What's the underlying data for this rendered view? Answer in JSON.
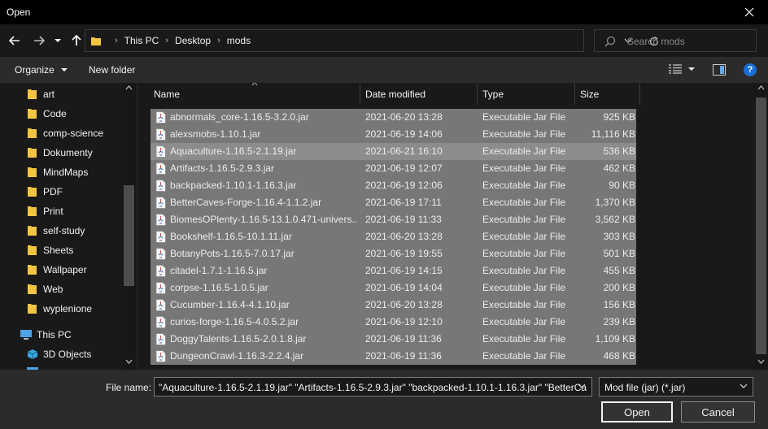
{
  "window": {
    "title": "Open"
  },
  "breadcrumbs": [
    "This PC",
    "Desktop",
    "mods"
  ],
  "search": {
    "placeholder": "Search mods"
  },
  "toolbar": {
    "organize_label": "Organize",
    "new_folder_label": "New folder",
    "help_label": "?"
  },
  "nav": {
    "folders": [
      "art",
      "Code",
      "comp-science",
      "Dokumenty",
      "MindMaps",
      "PDF",
      "Print",
      "self-study",
      "Sheets",
      "Wallpaper",
      "Web",
      "wyplenione"
    ],
    "this_pc": "This PC",
    "objects_3d": "3D Objects"
  },
  "columns": {
    "name": "Name",
    "date": "Date modified",
    "type": "Type",
    "size": "Size"
  },
  "files": [
    {
      "name": "abnormals_core-1.16.5-3.2.0.jar",
      "date": "2021-06-20 13:28",
      "type": "Executable Jar File",
      "size": "925 KB"
    },
    {
      "name": "alexsmobs-1.10.1.jar",
      "date": "2021-06-19 14:06",
      "type": "Executable Jar File",
      "size": "11,116 KB"
    },
    {
      "name": "Aquaculture-1.16.5-2.1.19.jar",
      "date": "2021-06-21 16:10",
      "type": "Executable Jar File",
      "size": "536 KB"
    },
    {
      "name": "Artifacts-1.16.5-2.9.3.jar",
      "date": "2021-06-19 12:07",
      "type": "Executable Jar File",
      "size": "462 KB"
    },
    {
      "name": "backpacked-1.10.1-1.16.3.jar",
      "date": "2021-06-19 12:06",
      "type": "Executable Jar File",
      "size": "90 KB"
    },
    {
      "name": "BetterCaves-Forge-1.16.4-1.1.2.jar",
      "date": "2021-06-19 17:11",
      "type": "Executable Jar File",
      "size": "1,370 KB"
    },
    {
      "name": "BiomesOPlenty-1.16.5-13.1.0.471-univers...",
      "date": "2021-06-19 11:33",
      "type": "Executable Jar File",
      "size": "3,562 KB"
    },
    {
      "name": "Bookshelf-1.16.5-10.1.11.jar",
      "date": "2021-06-20 13:28",
      "type": "Executable Jar File",
      "size": "303 KB"
    },
    {
      "name": "BotanyPots-1.16.5-7.0.17.jar",
      "date": "2021-06-19 19:55",
      "type": "Executable Jar File",
      "size": "501 KB"
    },
    {
      "name": "citadel-1.7.1-1.16.5.jar",
      "date": "2021-06-19 14:15",
      "type": "Executable Jar File",
      "size": "455 KB"
    },
    {
      "name": "corpse-1.16.5-1.0.5.jar",
      "date": "2021-06-19 14:04",
      "type": "Executable Jar File",
      "size": "200 KB"
    },
    {
      "name": "Cucumber-1.16.4-4.1.10.jar",
      "date": "2021-06-20 13:28",
      "type": "Executable Jar File",
      "size": "156 KB"
    },
    {
      "name": "curios-forge-1.16.5-4.0.5.2.jar",
      "date": "2021-06-19 12:10",
      "type": "Executable Jar File",
      "size": "239 KB"
    },
    {
      "name": "DoggyTalents-1.16.5-2.0.1.8.jar",
      "date": "2021-06-19 11:36",
      "type": "Executable Jar File",
      "size": "1,109 KB"
    },
    {
      "name": "DungeonCrawl-1.16.3-2.2.4.jar",
      "date": "2021-06-19 11:36",
      "type": "Executable Jar File",
      "size": "468 KB"
    }
  ],
  "bottom": {
    "file_name_label": "File name:",
    "file_name_value": "\"Aquaculture-1.16.5-2.1.19.jar\" \"Artifacts-1.16.5-2.9.3.jar\" \"backpacked-1.10.1-1.16.3.jar\" \"BetterCa",
    "filter_value": "Mod file (jar) (*.jar)",
    "open_label": "Open",
    "cancel_label": "Cancel"
  },
  "colors": {
    "selection": "#777777",
    "accent": "#1a6fd4",
    "folder": "#f4c542"
  }
}
